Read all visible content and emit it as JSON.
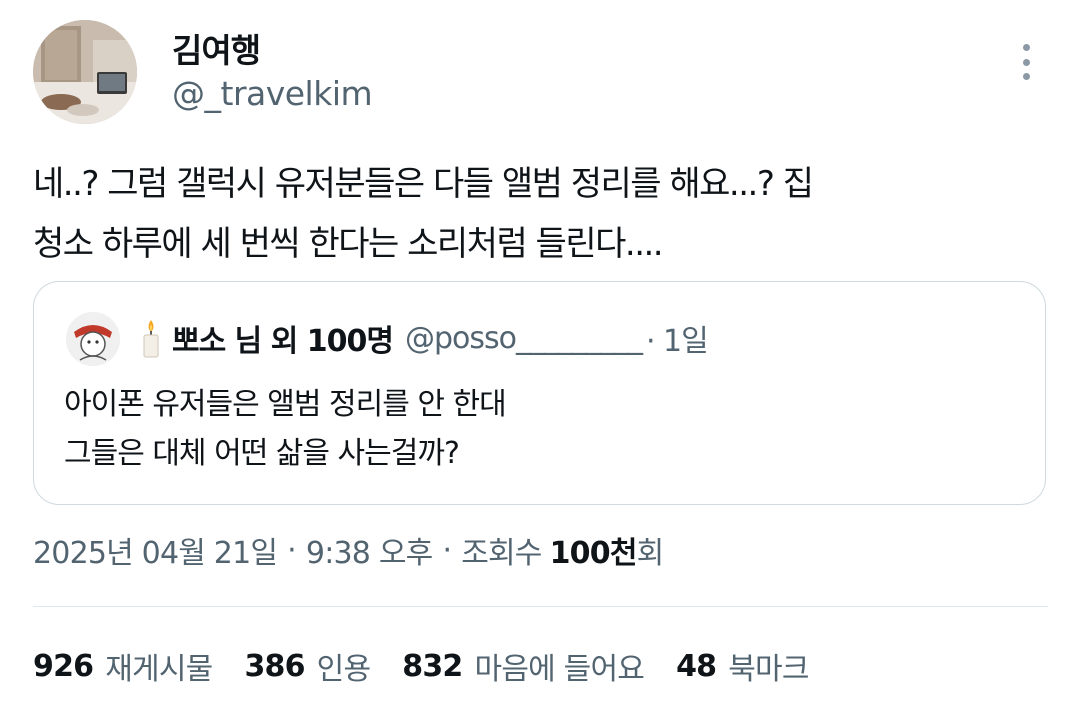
{
  "author": {
    "name": "김여행",
    "handle": "@_travelkim"
  },
  "tweet": {
    "text": "네..? 그럼 갤럭시 유저분들은 다들 앨범 정리를 해요...?  집\n청소 하루에 세 번씩 한다는 소리처럼 들린다...."
  },
  "quote": {
    "name": "뽀소 님 외 100명",
    "handle": "@posso_________",
    "time": "· 1일",
    "text": "아이폰 유저들은 앨범 정리를 안 한대\n그들은 대체 어떤 삶을 사는걸까?"
  },
  "meta": {
    "date": "2025년 04월 21일",
    "separator1": "·",
    "time": "9:38 오후",
    "separator2": "·",
    "views_label": "조회수",
    "views_value": "100천",
    "views_suffix": "회"
  },
  "stats": [
    {
      "count": "926",
      "label": "재게시물"
    },
    {
      "count": "386",
      "label": "인용"
    },
    {
      "count": "832",
      "label": "마음에 들어요"
    },
    {
      "count": "48",
      "label": "북마크"
    }
  ],
  "icons": {
    "more": "more-options-icon",
    "candle": "candle-emoji-icon"
  }
}
